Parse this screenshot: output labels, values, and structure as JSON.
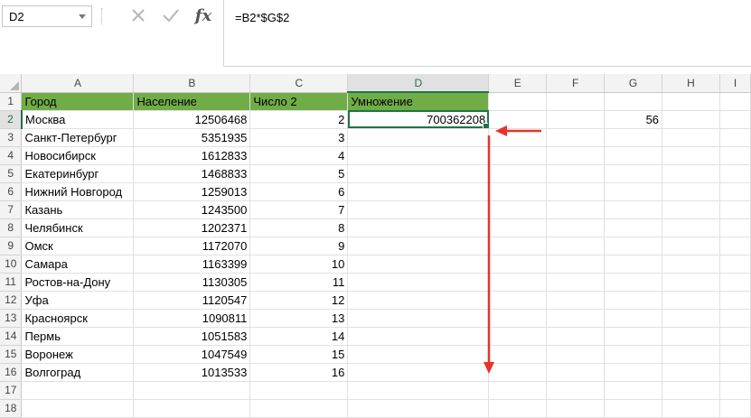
{
  "formula_bar": {
    "name_box": "D2",
    "formula": "=B2*$G$2",
    "cancel_icon": "close-icon",
    "enter_icon": "check-icon",
    "fx_label": "fx"
  },
  "columns": [
    "A",
    "B",
    "C",
    "D",
    "E",
    "F",
    "G",
    "H",
    "I"
  ],
  "selected_column": "D",
  "selected_row": "2",
  "row_numbers": [
    "1",
    "2",
    "3",
    "4",
    "5",
    "6",
    "7",
    "8",
    "9",
    "10",
    "11",
    "12",
    "13",
    "14",
    "15",
    "16",
    "17",
    "18"
  ],
  "header_row": {
    "a": "Город",
    "b": "Население",
    "c": "Число 2",
    "d": "Умножение"
  },
  "data_rows": [
    {
      "a": "Москва",
      "b": "12506468",
      "c": "2",
      "d": "700362208",
      "g": "56"
    },
    {
      "a": "Санкт-Петербург",
      "b": "5351935",
      "c": "3"
    },
    {
      "a": "Новосибирск",
      "b": "1612833",
      "c": "4"
    },
    {
      "a": "Екатеринбург",
      "b": "1468833",
      "c": "5"
    },
    {
      "a": "Нижний Новгород",
      "b": "1259013",
      "c": "6"
    },
    {
      "a": "Казань",
      "b": "1243500",
      "c": "7"
    },
    {
      "a": "Челябинск",
      "b": "1202371",
      "c": "8"
    },
    {
      "a": "Омск",
      "b": "1172070",
      "c": "9"
    },
    {
      "a": "Самара",
      "b": "1163399",
      "c": "10"
    },
    {
      "a": "Ростов-на-Дону",
      "b": "1130305",
      "c": "11"
    },
    {
      "a": "Уфа",
      "b": "1120547",
      "c": "12"
    },
    {
      "a": "Красноярск",
      "b": "1090811",
      "c": "13"
    },
    {
      "a": "Пермь",
      "b": "1051583",
      "c": "14"
    },
    {
      "a": "Воронеж",
      "b": "1047549",
      "c": "15"
    },
    {
      "a": "Волгоград",
      "b": "1013533",
      "c": "16"
    }
  ],
  "colors": {
    "header_fill": "#70ad47",
    "selection": "#217346",
    "annotation_arrow": "#e8322a"
  }
}
